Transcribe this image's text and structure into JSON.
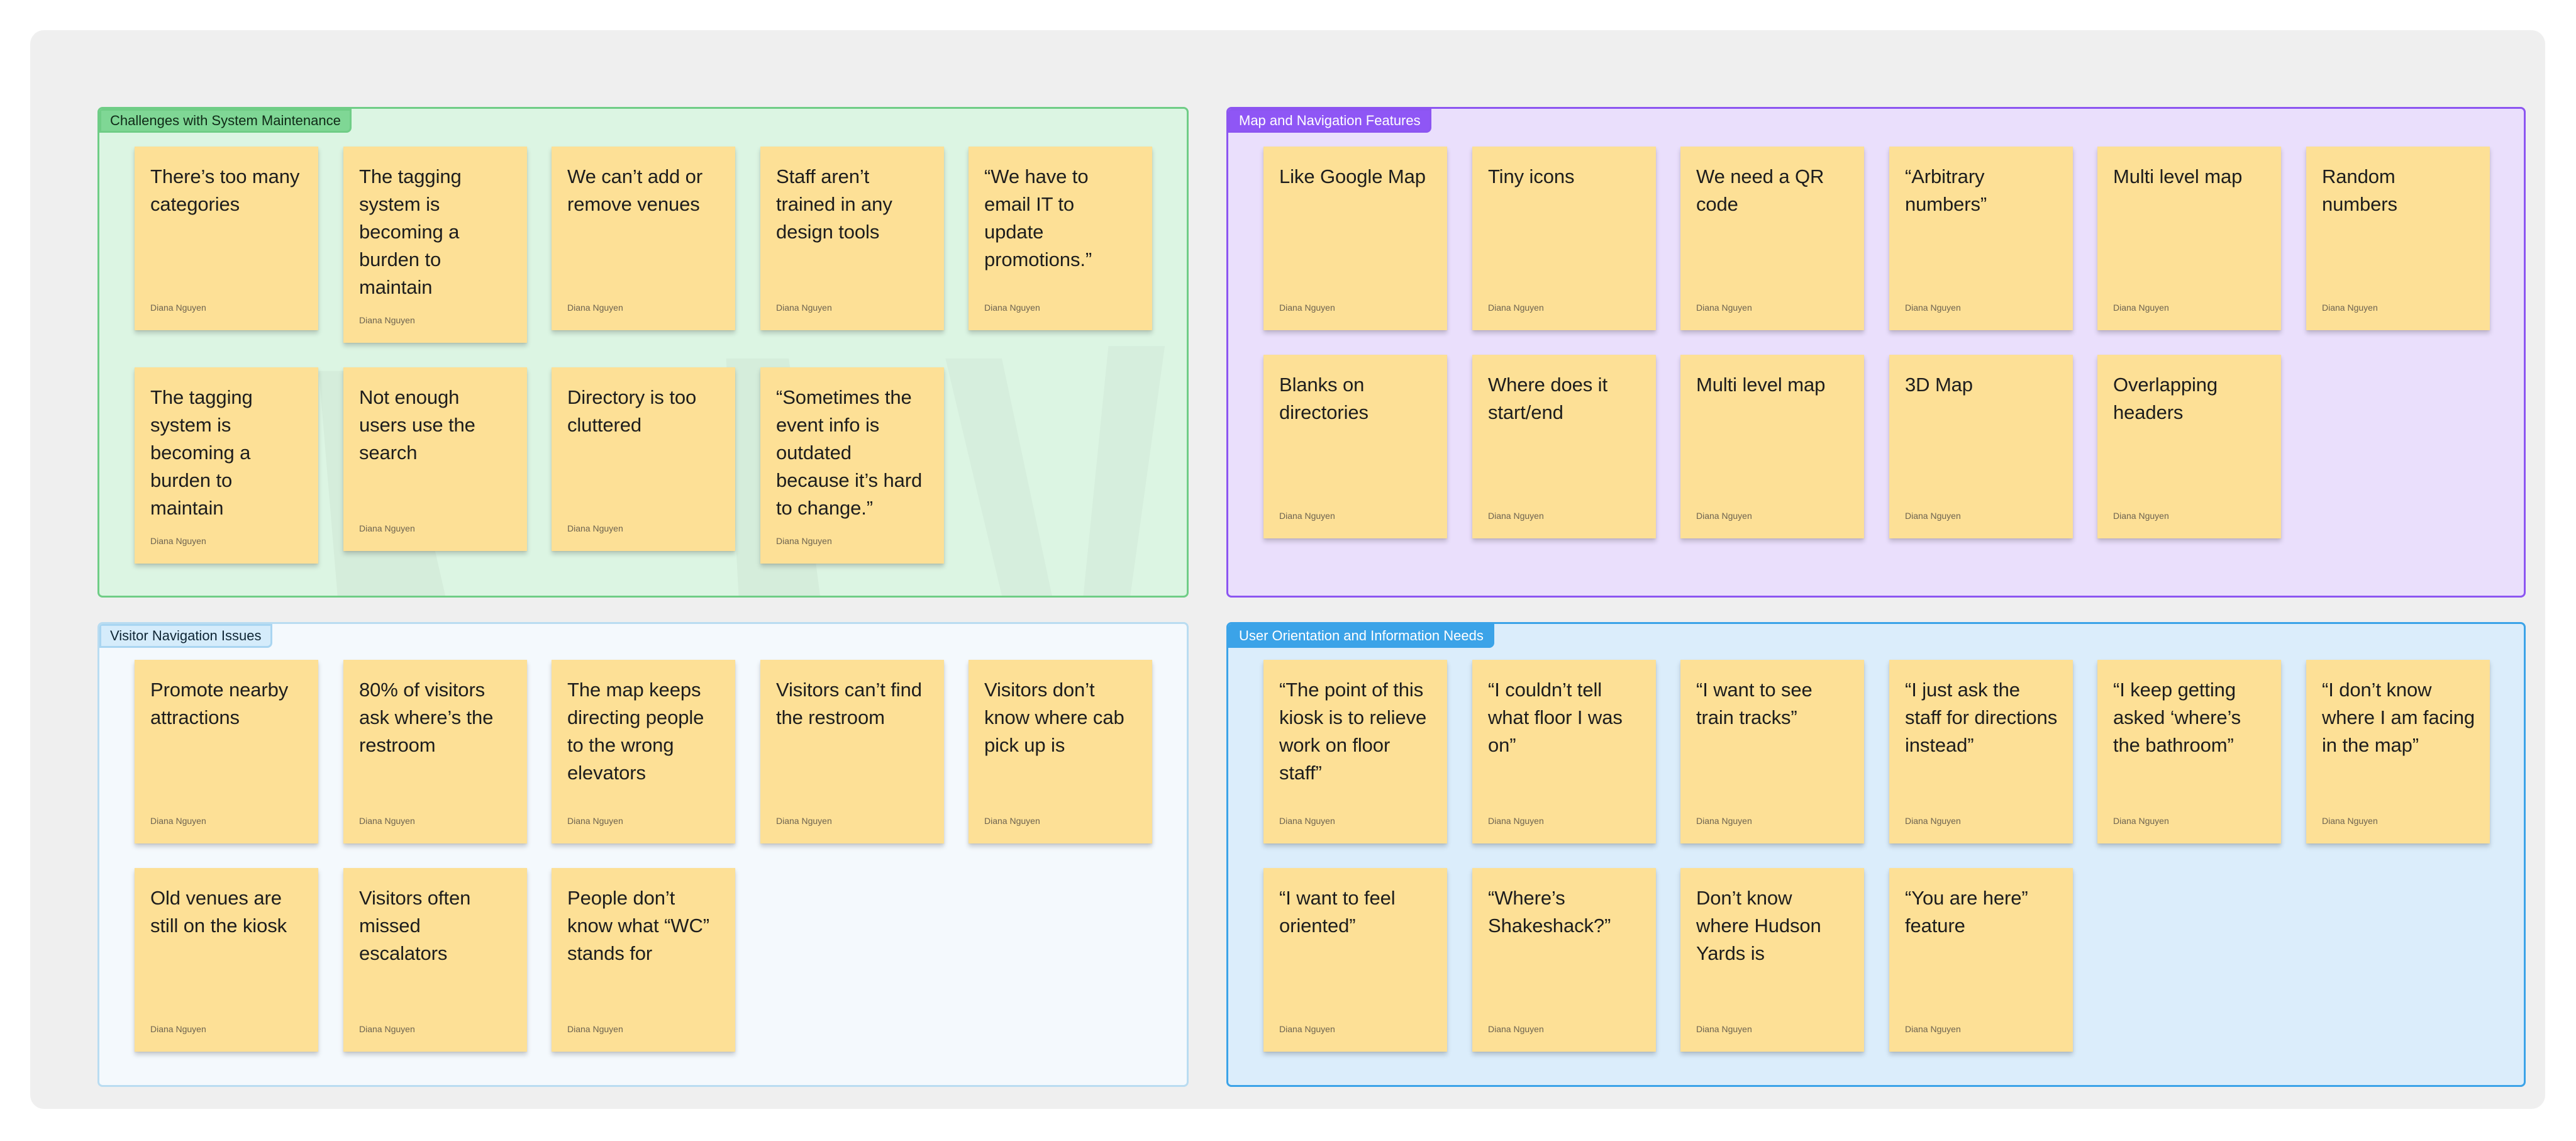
{
  "colors": {
    "canvas": "#efefef",
    "sticky_note": "#fde096",
    "challenges": "#7fd795",
    "map": "#8f56f5",
    "visitor": "#d5ecfb",
    "user": "#3ba3e8"
  },
  "sections": {
    "challenges": {
      "label": "Challenges with System Maintenance",
      "notes": [
        {
          "text": "There’s too many categories",
          "author": "Diana Nguyen"
        },
        {
          "text": "The tagging system is becoming a burden to maintain",
          "author": "Diana Nguyen"
        },
        {
          "text": "We can’t add or remove venues",
          "author": "Diana Nguyen"
        },
        {
          "text": "Staff aren’t trained in any design tools",
          "author": "Diana Nguyen"
        },
        {
          "text": "“We have to email IT to update promotions.”",
          "author": "Diana Nguyen"
        },
        {
          "text": "The tagging system is becoming a burden to maintain",
          "author": "Diana Nguyen"
        },
        {
          "text": "Not enough users use the search",
          "author": "Diana Nguyen"
        },
        {
          "text": "Directory is too cluttered",
          "author": "Diana Nguyen"
        },
        {
          "text": "“Sometimes the event info is outdated because it’s hard to change.”",
          "author": "Diana Nguyen"
        }
      ]
    },
    "map": {
      "label": "Map and Navigation Features",
      "notes": [
        {
          "text": "Like Google Map",
          "author": "Diana Nguyen"
        },
        {
          "text": "Tiny icons",
          "author": "Diana Nguyen"
        },
        {
          "text": "We need a QR code",
          "author": "Diana Nguyen"
        },
        {
          "text": "“Arbitrary numbers”",
          "author": "Diana Nguyen"
        },
        {
          "text": "Multi level map",
          "author": "Diana Nguyen"
        },
        {
          "text": "Random numbers",
          "author": "Diana Nguyen"
        },
        {
          "text": "Blanks on directories",
          "author": "Diana Nguyen"
        },
        {
          "text": "Where does it start/end",
          "author": "Diana Nguyen"
        },
        {
          "text": "Multi level map",
          "author": "Diana Nguyen"
        },
        {
          "text": "3D Map",
          "author": "Diana Nguyen"
        },
        {
          "text": "Overlapping headers",
          "author": "Diana Nguyen"
        }
      ]
    },
    "visitor": {
      "label": "Visitor Navigation Issues",
      "notes": [
        {
          "text": "Promote nearby attractions",
          "author": "Diana Nguyen"
        },
        {
          "text": "80% of visitors ask where’s the restroom",
          "author": "Diana Nguyen"
        },
        {
          "text": "The map keeps directing people to the wrong elevators",
          "author": "Diana Nguyen"
        },
        {
          "text": "Visitors can’t find the restroom",
          "author": "Diana Nguyen"
        },
        {
          "text": "Visitors don’t know where cab pick up is",
          "author": "Diana Nguyen"
        },
        {
          "text": "Old venues are still on the kiosk",
          "author": "Diana Nguyen"
        },
        {
          "text": "Visitors often missed escalators",
          "author": "Diana Nguyen"
        },
        {
          "text": "People don’t know what “WC” stands for",
          "author": "Diana Nguyen"
        }
      ]
    },
    "user": {
      "label": "User Orientation and Information Needs",
      "notes": [
        {
          "text": "“The point of this kiosk is to relieve work on floor staff”",
          "author": "Diana Nguyen"
        },
        {
          "text": "“I couldn’t tell what floor I was on”",
          "author": "Diana Nguyen"
        },
        {
          "text": "“I want to see train tracks”",
          "author": "Diana Nguyen"
        },
        {
          "text": "“I just ask the staff for directions instead”",
          "author": "Diana Nguyen"
        },
        {
          "text": "“I keep getting asked ‘where’s the bathroom”",
          "author": "Diana Nguyen"
        },
        {
          "text": "“I don’t know where I am facing in the map”",
          "author": "Diana Nguyen"
        },
        {
          "text": "“I want to feel oriented”",
          "author": "Diana Nguyen"
        },
        {
          "text": "“Where’s Shakeshack?”",
          "author": "Diana Nguyen"
        },
        {
          "text": "Don’t know where Hudson Yards is",
          "author": "Diana Nguyen"
        },
        {
          "text": "“You are here” feature",
          "author": "Diana Nguyen"
        }
      ]
    }
  }
}
